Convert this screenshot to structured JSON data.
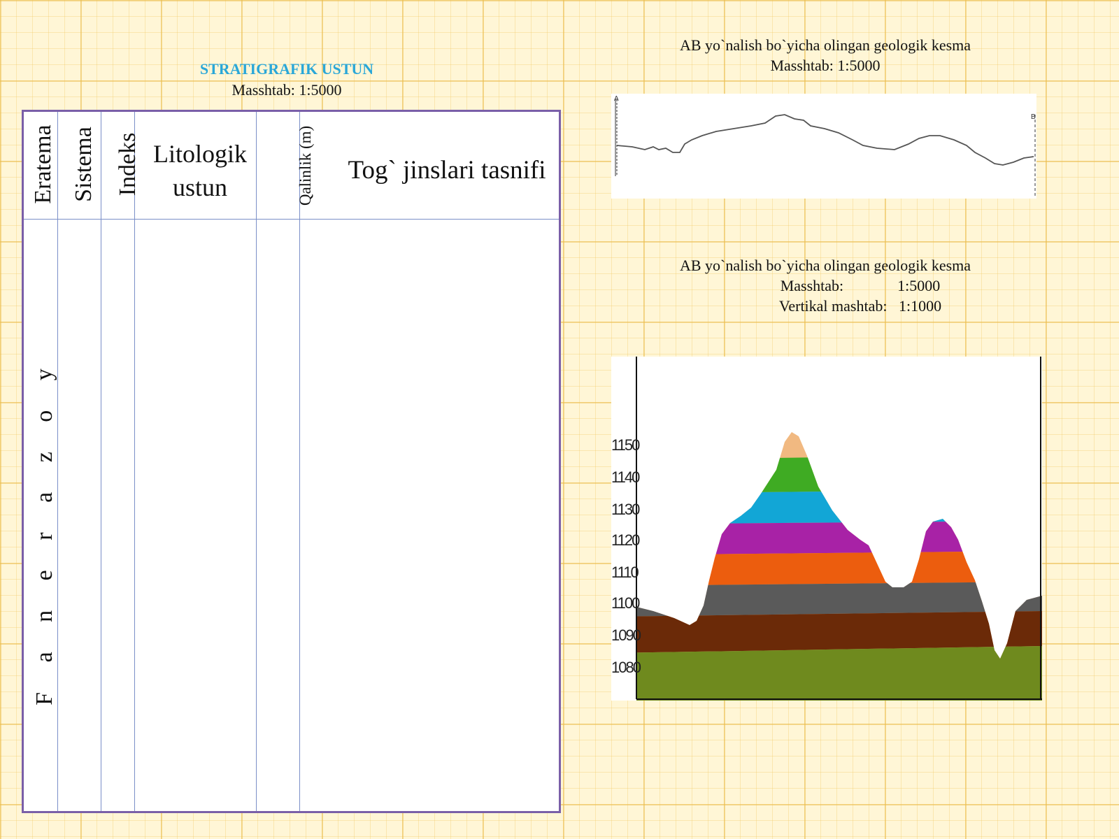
{
  "strat_column": {
    "title": "STRATIGRAFIK USTUN",
    "scale": "Masshtab:   1:5000",
    "headers": {
      "eratema": "Eratema",
      "sistema": "Sistema",
      "indeks": "Indeks",
      "litologik": "Litologik ustun",
      "qalinlik": "Qalinlik (m)",
      "tasnifi": "Tog` jinslari tasnifi"
    },
    "era_value": "F a n e r a z o y",
    "title_color": "#2aa7d8",
    "border_color": "#7a5fa8",
    "line_color": "#7a8fc8"
  },
  "profile_section": {
    "title": "AB yo`nalish bo`yicha olingan geologik kesma",
    "scale": "Masshtab:   1:5000",
    "label_a": "A",
    "label_b": "B"
  },
  "geologic_section": {
    "title": "AB yo`nalish bo`yicha olingan geologik kesma",
    "scale": "Masshtab:              1:5000",
    "vertical_scale": "Vertikal mashtab:   1:1000",
    "y_ticks": [
      "1150",
      "1140",
      "1130",
      "1120",
      "1110",
      "1100",
      "1090",
      "1080"
    ],
    "layer_colors": [
      "#6f8a1e",
      "#6b2a08",
      "#5a5a5a",
      "#ec5d0e",
      "#a822a6",
      "#12a6d6",
      "#3fab23",
      "#f1b981"
    ]
  }
}
